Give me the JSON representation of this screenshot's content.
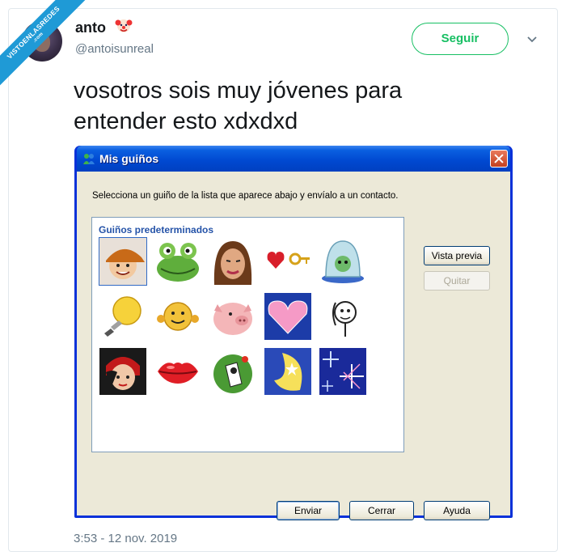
{
  "watermark": {
    "main": "VISTOENLASREDES",
    "sub": ".com"
  },
  "tweet": {
    "user_name": "anto",
    "user_handle": "@antoisunreal",
    "follow_label": "Seguir",
    "text_line1": "vosotros sois muy jóvenes para",
    "text_line2": "entender esto xdxdxd",
    "timestamp": "3:53 - 12 nov. 2019"
  },
  "dialog": {
    "title": "Mis guiños",
    "instruction": "Selecciona un guiño de la lista que aparece abajo y envíalo a un contacto.",
    "list_heading": "Guiños predeterminados",
    "buttons": {
      "preview": "Vista previa",
      "remove": "Quitar",
      "send": "Enviar",
      "close": "Cerrar",
      "help": "Ayuda"
    },
    "winks": [
      "cap-boy-icon",
      "frog-icon",
      "woman-face-icon",
      "heart-key-icon",
      "dome-alien-icon",
      "lightbulb-icon",
      "smiley-icon",
      "pig-icon",
      "heart-icon",
      "stickman-icon",
      "devil-girl-icon",
      "kiss-lips-icon",
      "green-creature-icon",
      "moon-icon",
      "sparkles-icon"
    ]
  },
  "colors": {
    "follow_green": "#17bf63",
    "xp_blue": "#0831d9",
    "xp_face": "#ece9d8",
    "heading_blue": "#2553a8"
  }
}
